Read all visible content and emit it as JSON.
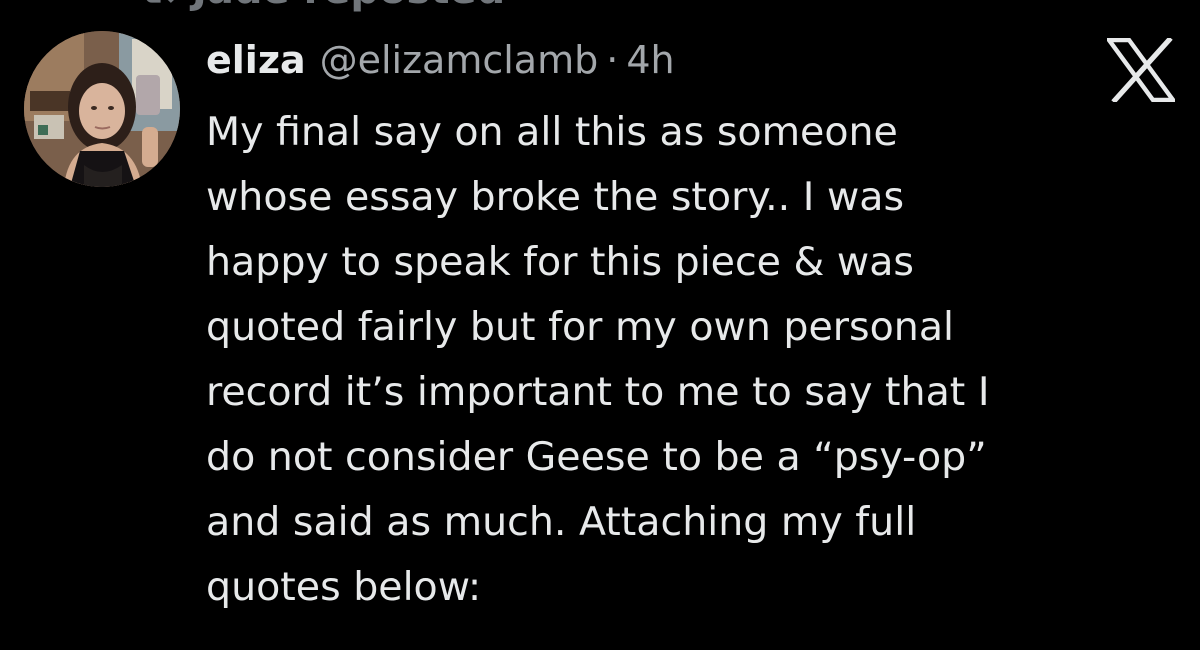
{
  "repost": {
    "label": "Jade reposted",
    "icon": "repost-icon"
  },
  "tweet": {
    "avatar_icon": "profile-photo",
    "display_name": "eliza",
    "handle": "@elizamclamb",
    "separator": "·",
    "timestamp": "4h",
    "platform_icon": "x-logo-icon",
    "text_lines": [
      "My final say on all this as someone",
      "whose essay broke the story.. I was",
      "happy to speak for this piece & was",
      "quoted fairly but for my own personal",
      "record it’s important to me to say that I",
      "do not consider Geese to be a “psy-op”",
      "and said as much. Attaching my full",
      "quotes below:"
    ]
  },
  "colors": {
    "background": "#000000",
    "primary_text": "#e7e9ea",
    "secondary_text": "#a3a7ab"
  }
}
